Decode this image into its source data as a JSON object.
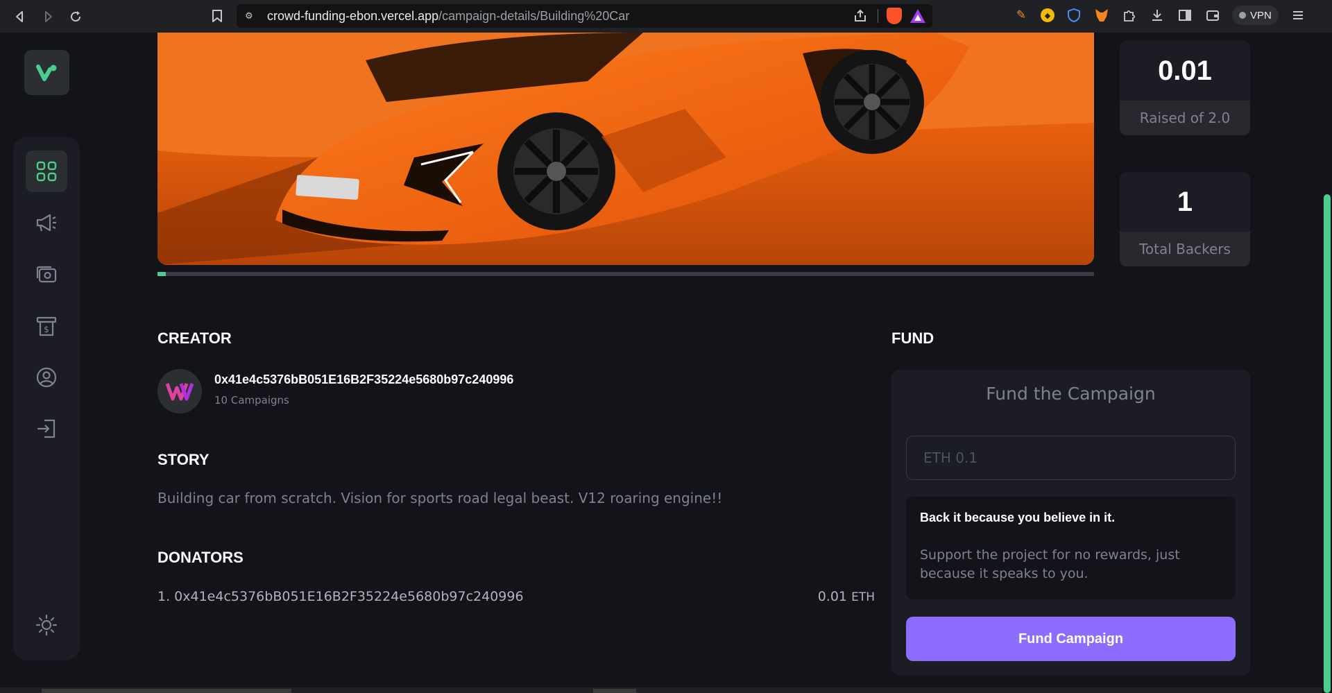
{
  "browser": {
    "url_host": "crowd-funding-ebon.vercel.app",
    "url_path": "/campaign-details/Building%20Car",
    "vpn_label": "VPN"
  },
  "colors": {
    "accent_green": "#4acd8d",
    "accent_purple": "#8c6dfd",
    "background": "#13131a",
    "card": "#1c1c24",
    "muted_text": "#808191"
  },
  "sidebar": {
    "items": [
      {
        "name": "dashboard-icon",
        "active": true
      },
      {
        "name": "megaphone-icon",
        "active": false
      },
      {
        "name": "payment-icon",
        "active": false
      },
      {
        "name": "withdraw-icon",
        "active": false
      },
      {
        "name": "profile-icon",
        "active": false
      },
      {
        "name": "logout-icon",
        "active": false
      }
    ],
    "theme_toggle": "sun-icon"
  },
  "campaign": {
    "image_alt": "Orange sports car",
    "progress_fraction": 0.005
  },
  "stats": {
    "raised_value": "0.01",
    "raised_label": "Raised of 2.0",
    "backers_value": "1",
    "backers_label": "Total Backers"
  },
  "creator": {
    "title": "CREATOR",
    "address": "0x41e4c5376bB051E16B2F35224e5680b97c240996",
    "campaigns": "10 Campaigns"
  },
  "story": {
    "title": "STORY",
    "text": "Building car from scratch. Vision for sports road legal beast. V12 roaring engine!!"
  },
  "donators": {
    "title": "DONATORS",
    "items": [
      {
        "label": "1. 0x41e4c5376bB051E16B2F35224e5680b97c240996",
        "amount": "0.01",
        "unit": "ETH"
      }
    ]
  },
  "fund": {
    "title": "FUND",
    "heading": "Fund the Campaign",
    "input_placeholder": "ETH 0.1",
    "believe_title": "Back it because you believe in it.",
    "believe_text": "Support the project for no rewards, just because it speaks to you.",
    "button_label": "Fund Campaign"
  }
}
